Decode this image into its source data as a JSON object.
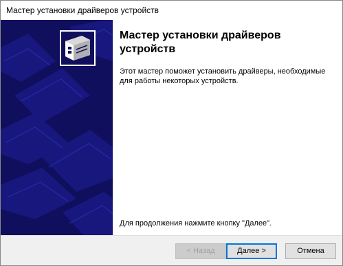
{
  "window": {
    "title": "Мастер установки драйверов устройств"
  },
  "content": {
    "heading": "Мастер установки драйверов устройств",
    "description": "Этот мастер поможет установить драйверы, необходимые для работы некоторых устройств.",
    "footer": "Для продолжения нажмите кнопку \"Далее\"."
  },
  "buttons": {
    "back": "< Назад",
    "next": "Далее >",
    "cancel": "Отмена"
  },
  "colors": {
    "banner": "#0f0f5e",
    "focus_border": "#0078d7"
  },
  "icons": {
    "banner_icon": "hardware-device-icon"
  }
}
